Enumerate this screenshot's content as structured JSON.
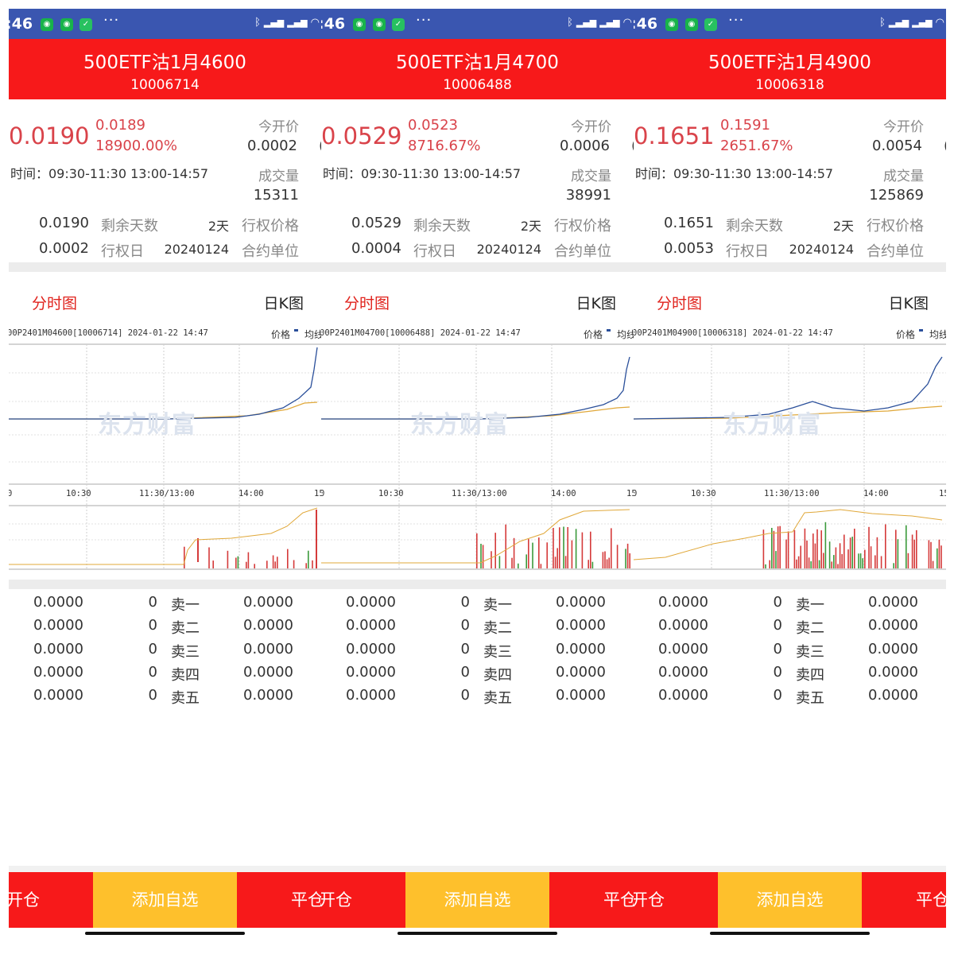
{
  "panels": [
    {
      "status": {
        "time": ":46"
      },
      "header": {
        "title": "500ETF沽1月4600",
        "code": "10006714"
      },
      "stats": {
        "price": "0.0190",
        "change": "0.0189",
        "change_pct": "18900.00%",
        "open_label": "今开价",
        "open_value": "0.0002",
        "trade_time": "时间：09:30-11:30 13:00-14:57",
        "volume_label": "成交量",
        "volume_value": "15311",
        "row1": {
          "value": "0.0190",
          "label": "剩余天数",
          "value2": "2天",
          "label2": "行权价格"
        },
        "row2": {
          "value": "0.0002",
          "label": "行权日",
          "value2": "20240124",
          "label2": "合约单位"
        }
      },
      "tabs": {
        "minute": "分时图",
        "daily": "日K图"
      },
      "chart": {
        "info": "00P2401M04600[10006714] 2024-01-22 14:47",
        "legend_price": "价格",
        "legend_avg": "均线",
        "watermark": "东方财富",
        "t0": "0",
        "t1": "10:30",
        "t2": "11:30/13:00",
        "t3": "14:00",
        "t4": "15"
      },
      "orderbook": [
        {
          "price": "0.0000",
          "qty": "0",
          "label": "卖一",
          "price2": "0.0000"
        },
        {
          "price": "0.0000",
          "qty": "0",
          "label": "卖二",
          "price2": "0.0000"
        },
        {
          "price": "0.0000",
          "qty": "0",
          "label": "卖三",
          "price2": "0.0000"
        },
        {
          "price": "0.0000",
          "qty": "0",
          "label": "卖四",
          "price2": "0.0000"
        },
        {
          "price": "0.0000",
          "qty": "0",
          "label": "卖五",
          "price2": "0.0000"
        }
      ],
      "bottom": {
        "left": "开仓",
        "middle": "添加自选",
        "right": "平仓"
      }
    },
    {
      "status": {
        "time": ":46"
      },
      "header": {
        "title": "500ETF沽1月4700",
        "code": "10006488"
      },
      "stats": {
        "price": "0.0529",
        "change": "0.0523",
        "change_pct": "8716.67%",
        "open_label": "今开价",
        "open_value": "0.0006",
        "trade_time": "时间：09:30-11:30 13:00-14:57",
        "volume_label": "成交量",
        "volume_value": "38991",
        "row1": {
          "value": "0.0529",
          "label": "剩余天数",
          "value2": "2天",
          "label2": "行权价格"
        },
        "row2": {
          "value": "0.0004",
          "label": "行权日",
          "value2": "20240124",
          "label2": "合约单位"
        }
      },
      "tabs": {
        "minute": "分时图",
        "daily": "日K图"
      },
      "chart": {
        "info": "00P2401M04700[10006488] 2024-01-22 14:47",
        "legend_price": "价格",
        "legend_avg": "均线",
        "watermark": "东方财富",
        "t0": "0",
        "t1": "10:30",
        "t2": "11:30/13:00",
        "t3": "14:00",
        "t4": "15"
      },
      "orderbook": [
        {
          "price": "0.0000",
          "qty": "0",
          "label": "卖一",
          "price2": "0.0000"
        },
        {
          "price": "0.0000",
          "qty": "0",
          "label": "卖二",
          "price2": "0.0000"
        },
        {
          "price": "0.0000",
          "qty": "0",
          "label": "卖三",
          "price2": "0.0000"
        },
        {
          "price": "0.0000",
          "qty": "0",
          "label": "卖四",
          "price2": "0.0000"
        },
        {
          "price": "0.0000",
          "qty": "0",
          "label": "卖五",
          "price2": "0.0000"
        }
      ],
      "bottom": {
        "left": "开仓",
        "middle": "添加自选",
        "right": "平仓"
      }
    },
    {
      "status": {
        "time": ":46"
      },
      "header": {
        "title": "500ETF沽1月4900",
        "code": "10006318"
      },
      "stats": {
        "price": "0.1651",
        "change": "0.1591",
        "change_pct": "2651.67%",
        "open_label": "今开价",
        "open_value": "0.0054",
        "trade_time": "时间：09:30-11:30 13:00-14:57",
        "volume_label": "成交量",
        "volume_value": "125869",
        "row1": {
          "value": "0.1651",
          "label": "剩余天数",
          "value2": "2天",
          "label2": "行权价格"
        },
        "row2": {
          "value": "0.0053",
          "label": "行权日",
          "value2": "20240124",
          "label2": "合约单位"
        }
      },
      "tabs": {
        "minute": "分时图",
        "daily": "日K图"
      },
      "chart": {
        "info": "00P2401M04900[10006318] 2024-01-22 14:47",
        "legend_price": "价格",
        "legend_avg": "均线",
        "watermark": "东方财富",
        "t0": "0",
        "t1": "10:30",
        "t2": "11:30/13:00",
        "t3": "14:00",
        "t4": "15"
      },
      "orderbook": [
        {
          "price": "0.0000",
          "qty": "0",
          "label": "卖一",
          "price2": "0.0000"
        },
        {
          "price": "0.0000",
          "qty": "0",
          "label": "卖二",
          "price2": "0.0000"
        },
        {
          "price": "0.0000",
          "qty": "0",
          "label": "卖三",
          "price2": "0.0000"
        },
        {
          "price": "0.0000",
          "qty": "0",
          "label": "卖四",
          "price2": "0.0000"
        },
        {
          "price": "0.0000",
          "qty": "0",
          "label": "卖五",
          "price2": "0.0000"
        }
      ],
      "bottom": {
        "left": "开仓",
        "middle": "添加自选",
        "right": "平仓"
      }
    }
  ],
  "colors": {
    "header_red": "#f7191a",
    "price_red": "#d9434a",
    "status_blue": "#3a56b0",
    "watchlist_yellow": "#fec02c",
    "price_line": "#2a4f9a",
    "avg_line": "#e0a83a"
  }
}
